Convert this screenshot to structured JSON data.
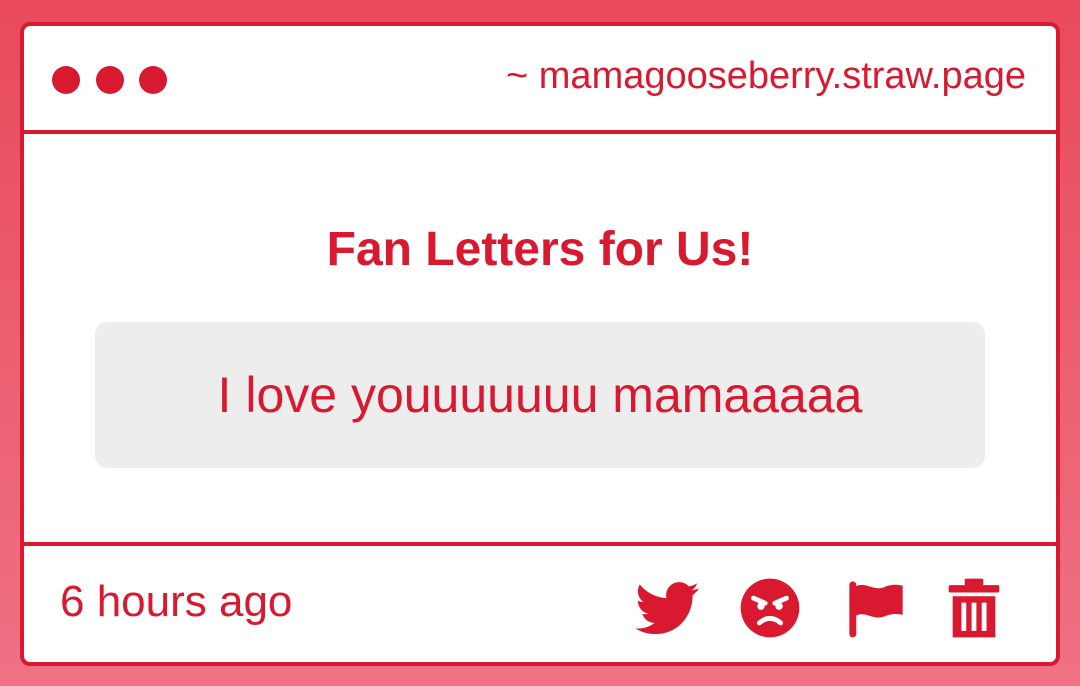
{
  "window": {
    "url": "~ mamagooseberry.straw.page"
  },
  "main": {
    "title": "Fan Letters for Us!",
    "message": "I love youuuuuuu mamaaaaa"
  },
  "footer": {
    "timestamp": "6 hours ago",
    "actions": [
      {
        "icon": "twitter-icon"
      },
      {
        "icon": "angry-face-icon"
      },
      {
        "icon": "flag-icon"
      },
      {
        "icon": "trash-icon"
      }
    ]
  },
  "colors": {
    "accent": "#d9192f",
    "background": "#e84a5c",
    "message_bg": "#eeedee"
  }
}
